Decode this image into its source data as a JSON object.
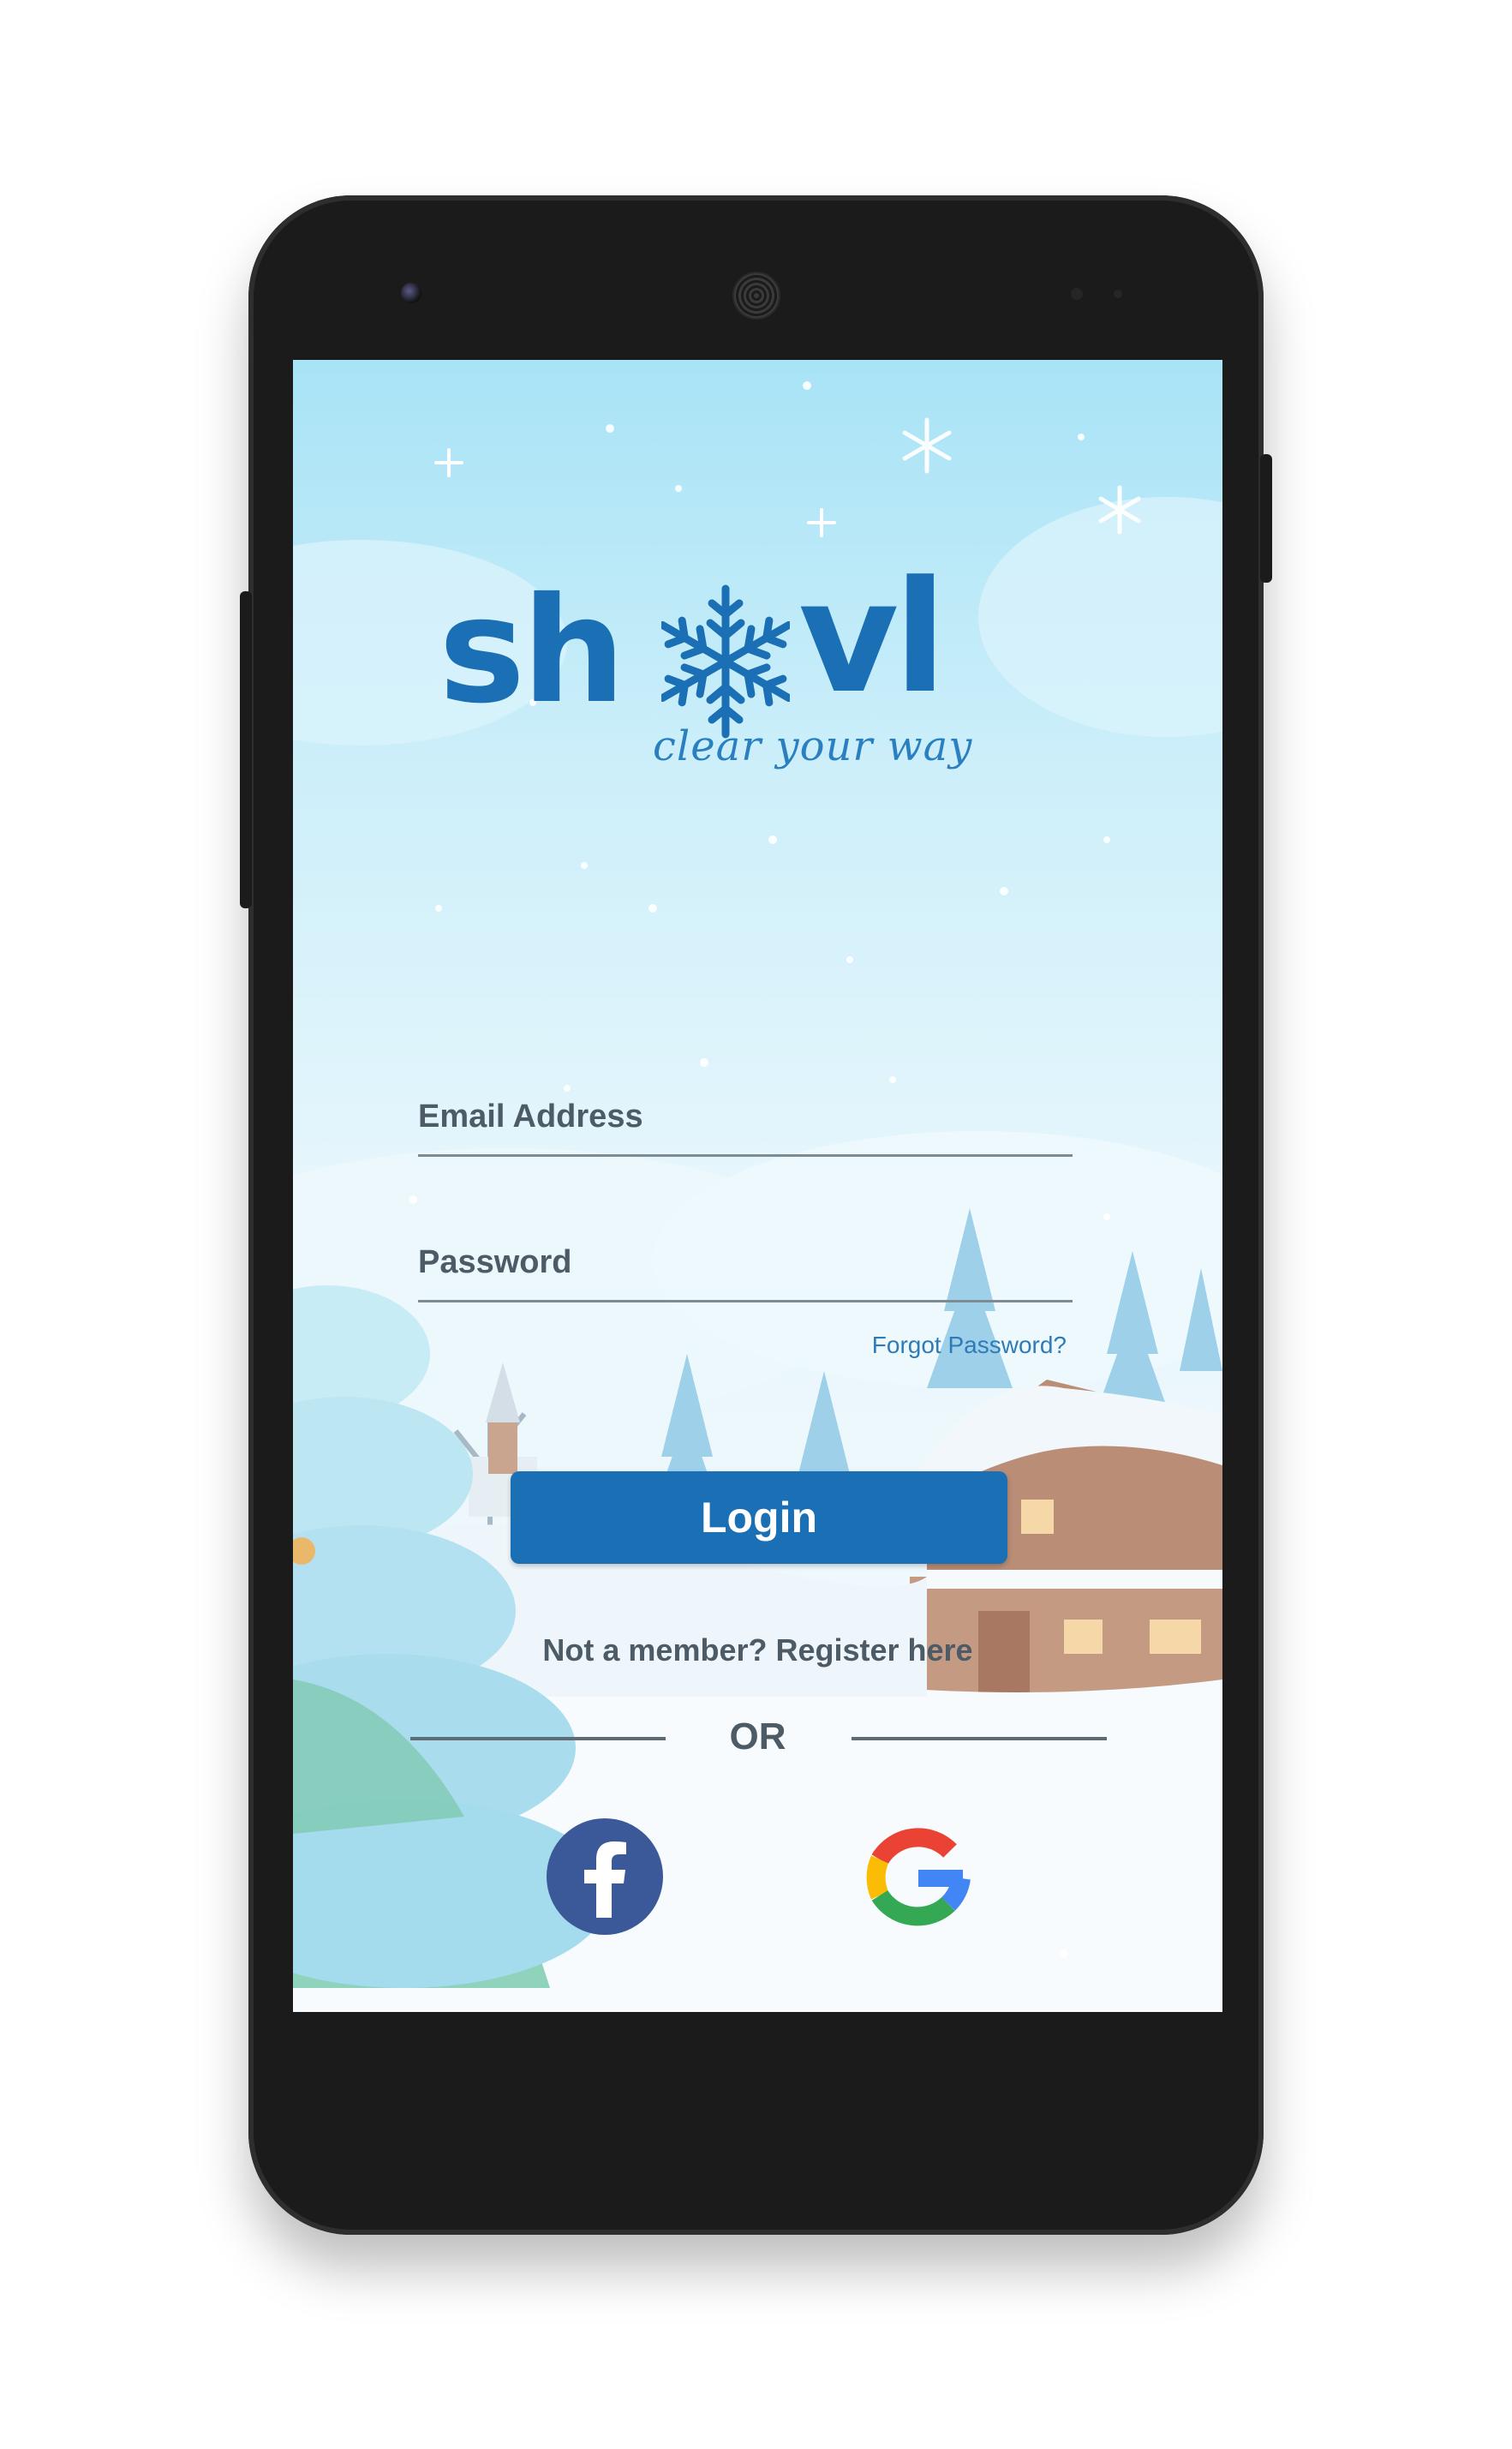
{
  "app": {
    "logo_text_left": "sh",
    "logo_text_right": "vl",
    "tagline": "clear your way"
  },
  "form": {
    "email_label": "Email Address",
    "password_label": "Password",
    "forgot_password": "Forgot Password?",
    "login_label": "Login",
    "register_text": "Not a member? Register here",
    "or_text": "OR"
  },
  "social": {
    "facebook_icon": "facebook-icon",
    "google_icon": "google-icon"
  },
  "colors": {
    "brand": "#1a6fb5",
    "text": "#4d5b66",
    "link": "#2f7bb8"
  }
}
